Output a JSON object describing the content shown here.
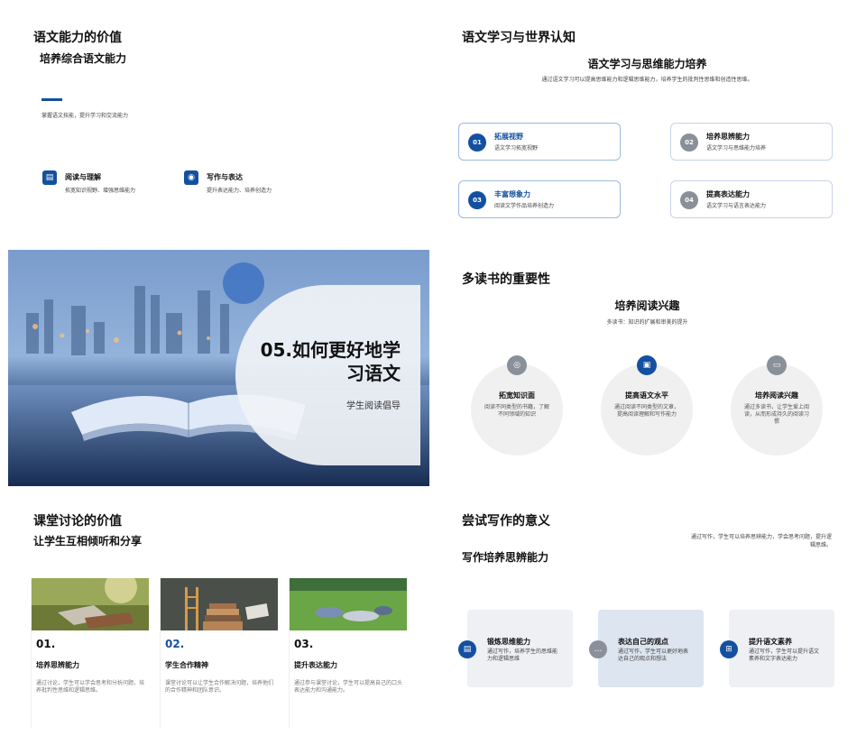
{
  "slide1": {
    "title": "语文能力的价值",
    "subtitle": "培养综合语文能力",
    "desc": "掌握语文技能，提升学习和交流能力",
    "items": [
      {
        "icon": "book-icon",
        "title": "阅读与理解",
        "desc": "拓宽知识视野、增强思维能力"
      },
      {
        "icon": "location-pin-icon",
        "title": "写作与表达",
        "desc": "提升表达能力、培养创造力"
      }
    ]
  },
  "slide2": {
    "title": "语文学习与世界认知",
    "subtitle": "语文学习与思维能力培养",
    "desc": "通过语文学习可以提高思维能力和逻辑思维能力，培养学生的批判性思维和创造性思维。",
    "cards": [
      {
        "num": "01",
        "title": "拓展视野",
        "desc": "语文学习拓宽视野"
      },
      {
        "num": "02",
        "title": "培养思辨能力",
        "desc": "语文学习与思维能力培养"
      },
      {
        "num": "03",
        "title": "丰富想象力",
        "desc": "阅读文学作品培养创造力"
      },
      {
        "num": "04",
        "title": "提高表达能力",
        "desc": "语文学习与语言表达能力"
      }
    ],
    "colors": {
      "primary": "#1450a0",
      "muted": "#8a9099"
    }
  },
  "slide3": {
    "title": "05.如何更好地学习语文",
    "subtitle": "学生阅读倡导"
  },
  "slide4": {
    "title": "多读书的重要性",
    "subtitle": "培养阅读兴趣",
    "desc": "多读书：知识的扩展和审美的提升",
    "circles": [
      {
        "icon": "globe-icon",
        "title": "拓宽知识面",
        "desc": "阅读不同类型的书籍，了解不同领域的知识"
      },
      {
        "icon": "image-icon",
        "title": "提高语文水平",
        "desc": "通过阅读不同类型的文章，提高阅读理解和写作能力"
      },
      {
        "icon": "inbox-icon",
        "title": "培养阅读兴趣",
        "desc": "通过多读书，让学生爱上阅读，从而形成持久的阅读习惯"
      }
    ]
  },
  "slide5": {
    "title": "课堂讨论的价值",
    "subtitle": "让学生互相倾听和分享",
    "cols": [
      {
        "num": "01.",
        "title": "培养思辨能力",
        "desc": "通过讨论，学生可以学会思考和分析问题，培养批判性思维和逻辑思维。"
      },
      {
        "num": "02.",
        "title": "学生合作精神",
        "desc": "课堂讨论可以让学生合作解决问题，培养他们的合作精神和团队意识。"
      },
      {
        "num": "03.",
        "title": "提升表达能力",
        "desc": "通过参与课堂讨论，学生可以提高自己的口头表达能力和沟通能力。"
      }
    ]
  },
  "slide6": {
    "title": "尝试写作的意义",
    "subtitle": "写作培养思辨能力",
    "desc": "通过写作，学生可以培养思辨能力，学会思考问题，提升逻辑思维。",
    "cards": [
      {
        "icon": "document-icon",
        "title": "锻炼思维能力",
        "desc": "通过写作，培养学生的思维能力和逻辑思维"
      },
      {
        "icon": "chat-icon",
        "title": "表达自己的观点",
        "desc": "通过写作，学生可以更好地表达自己的观点和想法"
      },
      {
        "icon": "hierarchy-icon",
        "title": "提升语文素养",
        "desc": "通过写作，学生可以提升语文素养和文字表达能力"
      }
    ]
  }
}
